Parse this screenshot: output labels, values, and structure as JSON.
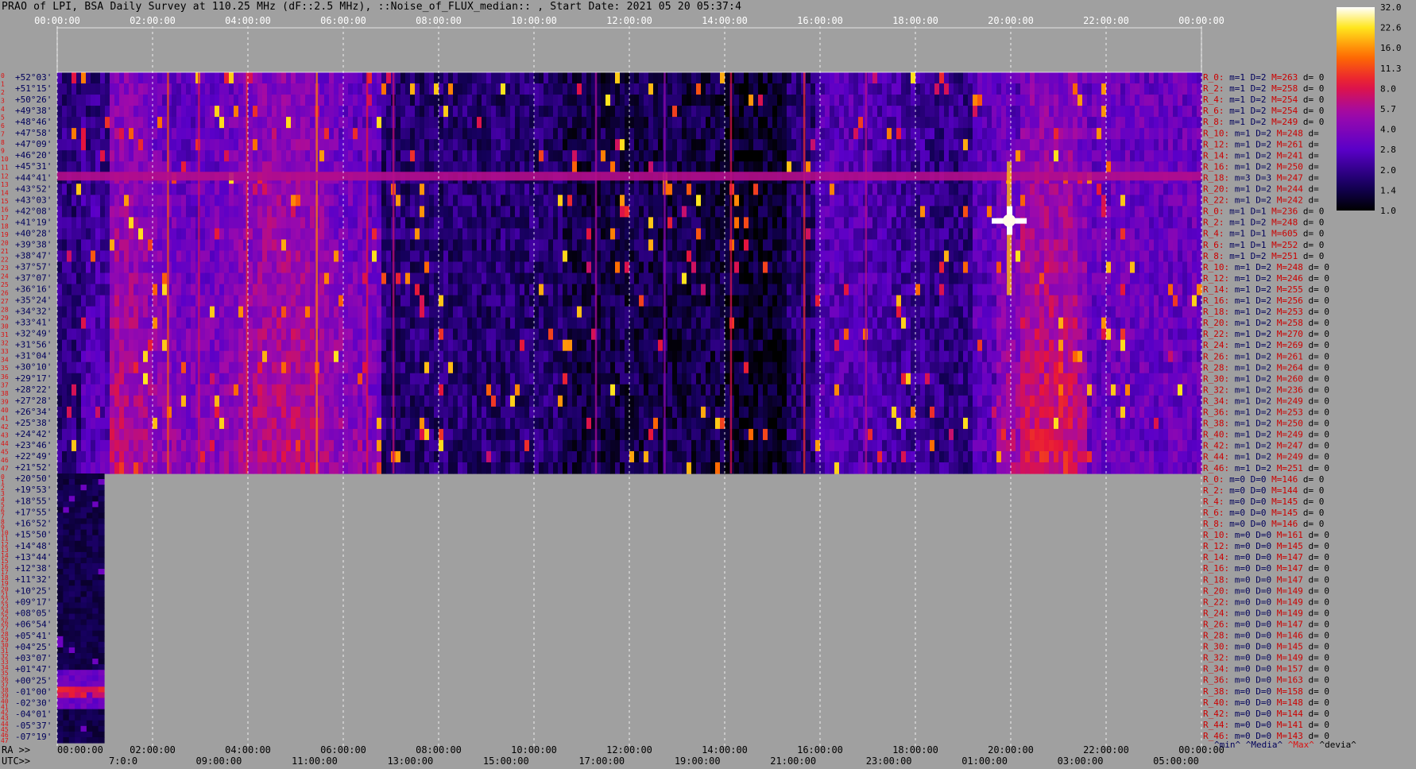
{
  "title": "PRAO of LPI, BSA Daily Survey at 110.25 MHz (dF::2.5 MHz), ::Noise_of_FLUX_median:: , Start Date: 2021 05 20 05:37:4",
  "colors": {
    "background": "#a0a0a0",
    "row_index": "#dd1111",
    "stat_label": "#cc0000",
    "stat_values": "#00005a",
    "gridline": "#ffffff"
  },
  "chart_data": {
    "type": "heatmap",
    "colormap": "black-blue-purple-red-orange-yellow-white",
    "colorbar": {
      "ticks": [
        "32.0",
        "22.6",
        "16.0",
        "11.3",
        "8.0",
        "5.7",
        "4.0",
        "2.8",
        "2.0",
        "1.4",
        "1.0"
      ],
      "min": 1.0,
      "max": 32.0,
      "scale": "log"
    },
    "top_time_ticks": [
      "00:00:00",
      "02:00:00",
      "04:00:00",
      "06:00:00",
      "08:00:00",
      "10:00:00",
      "12:00:00",
      "14:00:00",
      "16:00:00",
      "18:00:00",
      "20:00:00",
      "22:00:00",
      "00:00:00"
    ],
    "bottom_ra_prefix": "RA >>",
    "bottom_ra_ticks": [
      "00:00:00",
      "02:00:00",
      "04:00:00",
      "06:00:00",
      "08:00:00",
      "10:00:00",
      "12:00:00",
      "14:00:00",
      "16:00:00",
      "18:00:00",
      "20:00:00",
      "22:00:00",
      "00:00:00"
    ],
    "bottom_utc_prefix": "UTC>>",
    "bottom_utc_ticks": [
      "7:0:0",
      "09:00:00",
      "11:00:00",
      "13:00:00",
      "15:00:00",
      "17:00:00",
      "19:00:00",
      "21:00:00",
      "23:00:00",
      "01:00:00",
      "03:00:00",
      "05:00:00"
    ],
    "declinations_upper": [
      "+52°03'",
      "+51°15'",
      "+50°26'",
      "+49°38'",
      "+48°46'",
      "+47°58'",
      "+47°09'",
      "+46°20'",
      "+45°31'",
      "+44°41'",
      "+43°52'",
      "+43°03'",
      "+42°08'",
      "+41°19'",
      "+40°28'",
      "+39°38'",
      "+38°47'",
      "+37°57'",
      "+37°07'",
      "+36°16'",
      "+35°24'",
      "+34°32'",
      "+33°41'",
      "+32°49'",
      "+31°56'",
      "+31°04'",
      "+30°10'",
      "+29°17'",
      "+28°22'",
      "+27°28'",
      "+26°34'",
      "+25°38'",
      "+24°42'",
      "+23°46'",
      "+22°49'",
      "+21°52'"
    ],
    "declinations_lower": [
      "+20°50'",
      "+19°53'",
      "+18°55'",
      "+17°55'",
      "+16°52'",
      "+15°50'",
      "+14°48'",
      "+13°44'",
      "+12°38'",
      "+11°32'",
      "+10°25'",
      "+09°17'",
      "+08°05'",
      "+06°54'",
      "+05°41'",
      "+04°25'",
      "+03°07'",
      "+01°47'",
      "+00°25'",
      "-01°00'",
      "-02°30'",
      "-04°01'",
      "-05°37'",
      "-07°19'"
    ],
    "row_index_upper": [
      "0",
      "1",
      "2",
      "3",
      "4",
      "5",
      "6",
      "7",
      "8",
      "9",
      "10",
      "11",
      "12",
      "13",
      "14",
      "15",
      "16",
      "17",
      "18",
      "19",
      "20",
      "21",
      "22",
      "23",
      "24",
      "25",
      "26",
      "27",
      "28",
      "29",
      "30",
      "31",
      "32",
      "33",
      "34",
      "35",
      "36",
      "37",
      "38",
      "39",
      "40",
      "41",
      "42",
      "43",
      "44",
      "45",
      "46",
      "47"
    ],
    "row_index_lower": [
      "0",
      "1",
      "2",
      "3",
      "4",
      "5",
      "6",
      "7",
      "8",
      "9",
      "10",
      "11",
      "12",
      "13",
      "14",
      "15",
      "16",
      "17",
      "18",
      "19",
      "20",
      "21",
      "22",
      "23",
      "24",
      "25",
      "26",
      "27",
      "28",
      "29",
      "30",
      "31",
      "32",
      "33",
      "34",
      "35",
      "36",
      "37",
      "38",
      "39",
      "40",
      "41",
      "42",
      "43",
      "44",
      "45",
      "46",
      "47"
    ],
    "stats_rows": [
      {
        "r": "R_0:",
        "v": "m=1 D=2 ",
        "M": "M=263",
        "d": " d= 0"
      },
      {
        "r": "R_2:",
        "v": "m=1 D=2 ",
        "M": "M=258",
        "d": " d= 0"
      },
      {
        "r": "R_4:",
        "v": "m=1 D=2 ",
        "M": "M=254",
        "d": " d= 0"
      },
      {
        "r": "R_6:",
        "v": "m=1 D=2 ",
        "M": "M=254",
        "d": " d= 0"
      },
      {
        "r": "R_8:",
        "v": "m=1 D=2 ",
        "M": "M=249",
        "d": " d= 0"
      },
      {
        "r": "R_10:",
        "v": "m=1 D=2 ",
        "M": "M=248",
        "d": " d="
      },
      {
        "r": "R_12:",
        "v": "m=1 D=2 ",
        "M": "M=261",
        "d": " d="
      },
      {
        "r": "R_14:",
        "v": "m=1 D=2 ",
        "M": "M=241",
        "d": " d="
      },
      {
        "r": "R_16:",
        "v": "m=1 D=2 ",
        "M": "M=250",
        "d": " d="
      },
      {
        "r": "R_18:",
        "v": "m=3 D=3 ",
        "M": "M=247",
        "d": " d="
      },
      {
        "r": "R_20:",
        "v": "m=1 D=2 ",
        "M": "M=244",
        "d": " d="
      },
      {
        "r": "R_22:",
        "v": "m=1 D=2 ",
        "M": "M=242",
        "d": " d="
      },
      {
        "r": "R_0:",
        "v": "m=1 D=1 ",
        "M": "M=236",
        "d": " d= 0"
      },
      {
        "r": "R_2:",
        "v": "m=1 D=2 ",
        "M": "M=248",
        "d": " d= 0"
      },
      {
        "r": "R_4:",
        "v": "m=1 D=1 ",
        "M": "M=605",
        "d": " d= 0"
      },
      {
        "r": "R_6:",
        "v": "m=1 D=1 ",
        "M": "M=252",
        "d": " d= 0"
      },
      {
        "r": "R_8:",
        "v": "m=1 D=2 ",
        "M": "M=251",
        "d": " d= 0"
      },
      {
        "r": "R_10:",
        "v": "m=1 D=2 ",
        "M": "M=248",
        "d": " d= 0"
      },
      {
        "r": "R_12:",
        "v": "m=1 D=2 ",
        "M": "M=246",
        "d": " d= 0"
      },
      {
        "r": "R_14:",
        "v": "m=1 D=2 ",
        "M": "M=255",
        "d": " d= 0"
      },
      {
        "r": "R_16:",
        "v": "m=1 D=2 ",
        "M": "M=256",
        "d": " d= 0"
      },
      {
        "r": "R_18:",
        "v": "m=1 D=2 ",
        "M": "M=253",
        "d": " d= 0"
      },
      {
        "r": "R_20:",
        "v": "m=1 D=2 ",
        "M": "M=258",
        "d": " d= 0"
      },
      {
        "r": "R_22:",
        "v": "m=1 D=2 ",
        "M": "M=270",
        "d": " d= 0"
      },
      {
        "r": "R_24:",
        "v": "m=1 D=2 ",
        "M": "M=269",
        "d": " d= 0"
      },
      {
        "r": "R_26:",
        "v": "m=1 D=2 ",
        "M": "M=261",
        "d": " d= 0"
      },
      {
        "r": "R_28:",
        "v": "m=1 D=2 ",
        "M": "M=264",
        "d": " d= 0"
      },
      {
        "r": "R_30:",
        "v": "m=1 D=2 ",
        "M": "M=260",
        "d": " d= 0"
      },
      {
        "r": "R_32:",
        "v": "m=1 D=2 ",
        "M": "M=236",
        "d": " d= 0"
      },
      {
        "r": "R_34:",
        "v": "m=1 D=2 ",
        "M": "M=249",
        "d": " d= 0"
      },
      {
        "r": "R_36:",
        "v": "m=1 D=2 ",
        "M": "M=253",
        "d": " d= 0"
      },
      {
        "r": "R_38:",
        "v": "m=1 D=2 ",
        "M": "M=250",
        "d": " d= 0"
      },
      {
        "r": "R_40:",
        "v": "m=1 D=2 ",
        "M": "M=249",
        "d": " d= 0"
      },
      {
        "r": "R_42:",
        "v": "m=1 D=2 ",
        "M": "M=247",
        "d": " d= 0"
      },
      {
        "r": "R_44:",
        "v": "m=1 D=2 ",
        "M": "M=249",
        "d": " d= 0"
      },
      {
        "r": "R_46:",
        "v": "m=1 D=2 ",
        "M": "M=251",
        "d": " d= 0"
      },
      {
        "r": "R_0:",
        "v": "m=0 D=0 ",
        "M": "M=146",
        "d": " d= 0"
      },
      {
        "r": "R_2:",
        "v": "m=0 D=0 ",
        "M": "M=144",
        "d": " d= 0"
      },
      {
        "r": "R_4:",
        "v": "m=0 D=0 ",
        "M": "M=145",
        "d": " d= 0"
      },
      {
        "r": "R_6:",
        "v": "m=0 D=0 ",
        "M": "M=145",
        "d": " d= 0"
      },
      {
        "r": "R_8:",
        "v": "m=0 D=0 ",
        "M": "M=146",
        "d": " d= 0"
      },
      {
        "r": "R_10:",
        "v": "m=0 D=0 ",
        "M": "M=161",
        "d": " d= 0"
      },
      {
        "r": "R_12:",
        "v": "m=0 D=0 ",
        "M": "M=145",
        "d": " d= 0"
      },
      {
        "r": "R_14:",
        "v": "m=0 D=0 ",
        "M": "M=147",
        "d": " d= 0"
      },
      {
        "r": "R_16:",
        "v": "m=0 D=0 ",
        "M": "M=147",
        "d": " d= 0"
      },
      {
        "r": "R_18:",
        "v": "m=0 D=0 ",
        "M": "M=147",
        "d": " d= 0"
      },
      {
        "r": "R_20:",
        "v": "m=0 D=0 ",
        "M": "M=149",
        "d": " d= 0"
      },
      {
        "r": "R_22:",
        "v": "m=0 D=0 ",
        "M": "M=149",
        "d": " d= 0"
      },
      {
        "r": "R_24:",
        "v": "m=0 D=0 ",
        "M": "M=149",
        "d": " d= 0"
      },
      {
        "r": "R_26:",
        "v": "m=0 D=0 ",
        "M": "M=147",
        "d": " d= 0"
      },
      {
        "r": "R_28:",
        "v": "m=0 D=0 ",
        "M": "M=146",
        "d": " d= 0"
      },
      {
        "r": "R_30:",
        "v": "m=0 D=0 ",
        "M": "M=145",
        "d": " d= 0"
      },
      {
        "r": "R_32:",
        "v": "m=0 D=0 ",
        "M": "M=149",
        "d": " d= 0"
      },
      {
        "r": "R_34:",
        "v": "m=0 D=0 ",
        "M": "M=157",
        "d": " d= 0"
      },
      {
        "r": "R_36:",
        "v": "m=0 D=0 ",
        "M": "M=163",
        "d": " d= 0"
      },
      {
        "r": "R_38:",
        "v": "m=0 D=0 ",
        "M": "M=158",
        "d": " d= 0"
      },
      {
        "r": "R_40:",
        "v": "m=0 D=0 ",
        "M": "M=148",
        "d": " d= 0"
      },
      {
        "r": "R_42:",
        "v": "m=0 D=0 ",
        "M": "M=144",
        "d": " d= 0"
      },
      {
        "r": "R_44:",
        "v": "m=0 D=0 ",
        "M": "M=141",
        "d": " d= 0"
      },
      {
        "r": "R_46:",
        "v": "m=0 D=0 ",
        "M": "M=143",
        "d": " d= 0"
      }
    ],
    "stats_legend": [
      {
        "text": "^min^",
        "color": "#00005a"
      },
      {
        "text": "^Media^",
        "color": "#00005a"
      },
      {
        "text": "^Max^",
        "color": "#dd1111"
      },
      {
        "text": "^devia^",
        "color": "#000000"
      }
    ]
  }
}
